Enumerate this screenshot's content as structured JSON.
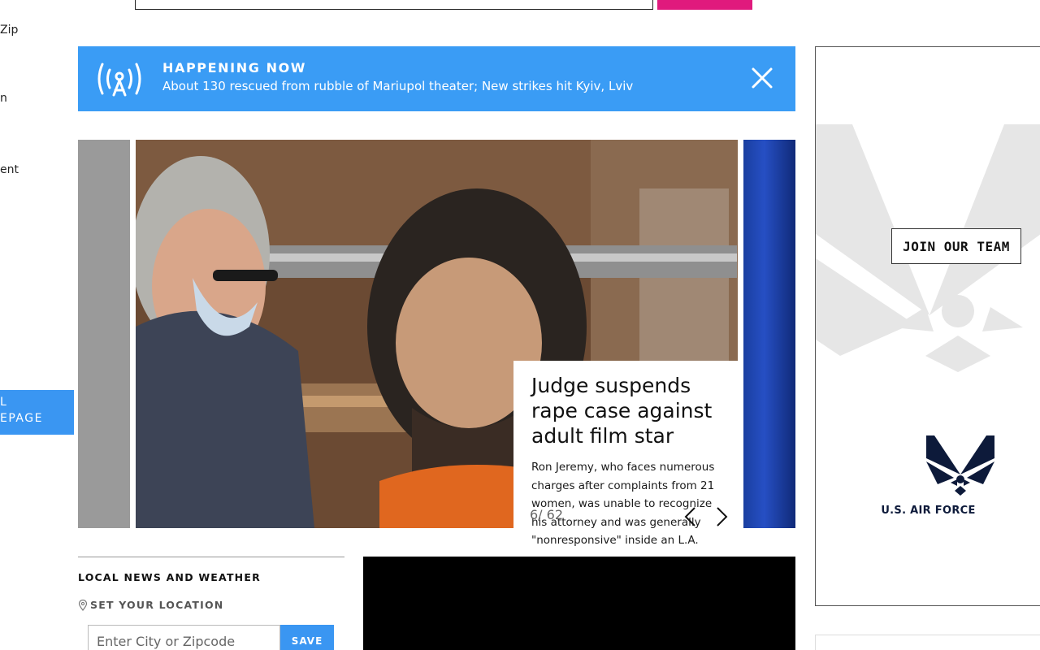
{
  "sidebar": {
    "items": [
      "Zip",
      "n",
      "ent"
    ],
    "homepage_label_1": "L",
    "homepage_label_2": "EPAGE"
  },
  "banner": {
    "kicker": "HAPPENING NOW",
    "headline": "About 130 rescued from rubble of Mariupol theater; New strikes hit Kyiv, Lviv",
    "icon": "broadcast-icon",
    "close_icon": "close-icon",
    "color": "#3a9cf5"
  },
  "carousel": {
    "title": "Judge suspends rape case against adult film star",
    "summary": "Ron Jeremy, who faces numerous charges after complaints from 21 women, was unable to recognize his attorney and was generally \"nonresponsive\" inside an L.A.",
    "counter": "6/ 62"
  },
  "local": {
    "title": "LOCAL NEWS AND WEATHER",
    "set_location": "SET YOUR LOCATION",
    "placeholder": "Enter City or Zipcode",
    "save_label": "SAVE"
  },
  "ad": {
    "cta": "JOIN OUR TEAM",
    "brand": "U.S. AIR FORCE"
  },
  "colors": {
    "accent": "#3a96f2",
    "pink": "#e01a7d"
  }
}
